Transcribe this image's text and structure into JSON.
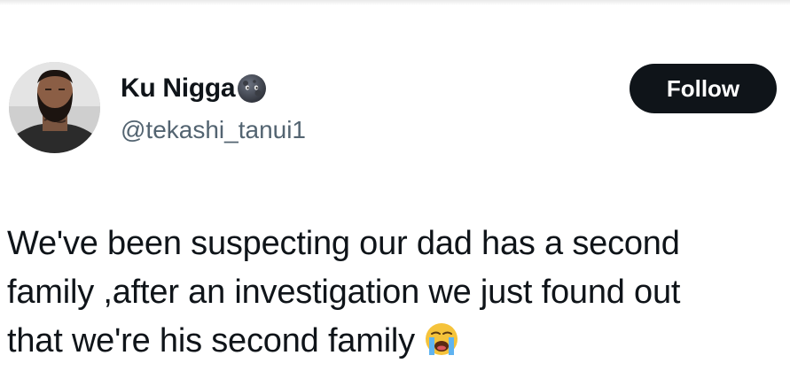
{
  "tweet": {
    "author": {
      "display_name": "Ku Nigga",
      "handle": "@tekashi_tanui1",
      "name_emoji": "new-moon-face-icon"
    },
    "follow_label": "Follow",
    "text_lines": [
      "We've been suspecting our dad has a second",
      "family ,after an investigation we just found out",
      "that we're his second family"
    ],
    "trailing_emoji": "loudly-crying-face-icon"
  },
  "colors": {
    "text": "#0f1419",
    "secondary_text": "#536471",
    "button_bg": "#0f1419",
    "button_text": "#ffffff",
    "background": "#ffffff"
  }
}
